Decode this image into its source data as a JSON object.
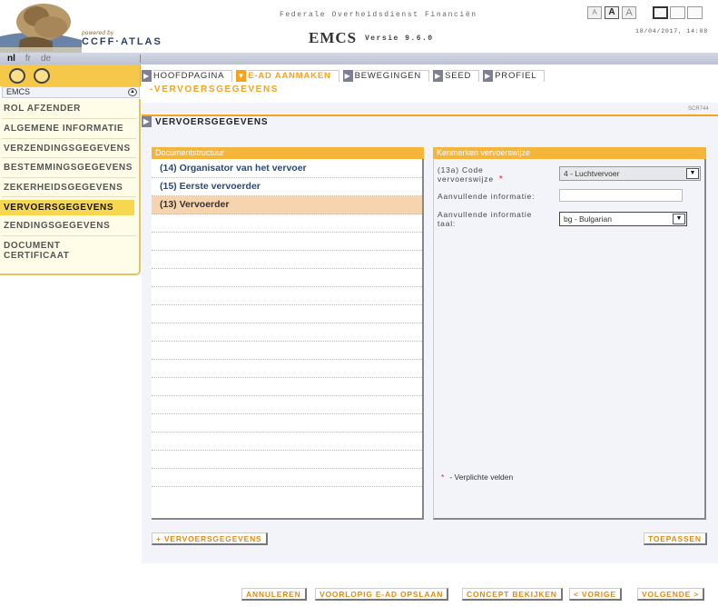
{
  "header": {
    "powered_by": "powered by",
    "brand": "CCFF·ATLAS",
    "agency": "Federale Overheidsdienst Financiën",
    "app_title": "EMCS",
    "app_version": "Versie 9.6.0",
    "timestamp": "18/04/2017, 14:08",
    "font_sizes": [
      "A",
      "A",
      "A"
    ]
  },
  "languages": [
    "nl",
    "fr",
    "de"
  ],
  "sidebar": {
    "heading": "EMCS",
    "items": [
      {
        "label": "ROL AFZENDER",
        "active": false
      },
      {
        "label": "ALGEMENE INFORMATIE",
        "active": false
      },
      {
        "label": "VERZENDINGSGEGEVENS",
        "active": false
      },
      {
        "label": "BESTEMMINGSGEGEVENS",
        "active": false
      },
      {
        "label": "ZEKERHEIDSGEGEVENS",
        "active": false
      },
      {
        "label": "VERVOERSGEGEVENS",
        "active": true
      },
      {
        "label": "ZENDINGSGEGEVENS",
        "active": false
      },
      {
        "label": "DOCUMENT CERTIFICAAT",
        "active": false
      }
    ]
  },
  "nav_tabs": [
    {
      "label": "HOOFDPAGINA",
      "active": false
    },
    {
      "label": "E-AD AANMAKEN",
      "active": true
    },
    {
      "label": "BEWEGINGEN",
      "active": false
    },
    {
      "label": "SEED",
      "active": false
    },
    {
      "label": "PROFIEL",
      "active": false
    }
  ],
  "section_label": "-VERVOERSGEGEVENS",
  "screen_id": "SCR744",
  "page_heading": "VERVOERSGEGEVENS",
  "document_structure": {
    "title": "Documentstructuur",
    "rows": [
      {
        "label": "(14) Organisator van het vervoer",
        "selected": false
      },
      {
        "label": "(15) Eerste vervoerder",
        "selected": false
      },
      {
        "label": "(13) Vervoerder",
        "selected": true
      }
    ]
  },
  "transport_panel": {
    "title": "Kenmerken vervoerswijze",
    "code_label_line1": "(13a) Code",
    "code_label_line2": "vervoerswijze",
    "required_mark": "*",
    "code_value": "4 - Luchtvervoer",
    "extra_info_label": "Aanvullende informatie:",
    "extra_info_value": "",
    "lang_label_line1": "Aanvullende informatie",
    "lang_label_line2": "taal:",
    "lang_value": "bg - Bulgarian",
    "required_note": "- Verplichte velden"
  },
  "buttons": {
    "add_transport": "+ VERVOERSGEGEVENS",
    "apply": "TOEPASSEN",
    "cancel": "ANNULEREN",
    "save_draft": "VOORLOPIG E-AD OPSLAAN",
    "view_concept": "CONCEPT BEKIJKEN",
    "previous": "< VORIGE",
    "next": "VOLGENDE >"
  },
  "colors": {
    "accent_orange": "#f5a31a",
    "panel_header": "#f5b53a",
    "sidebar_yellow": "#f5c84a",
    "selected_row": "#f7d4b0",
    "link_blue": "#2a4a7a"
  }
}
